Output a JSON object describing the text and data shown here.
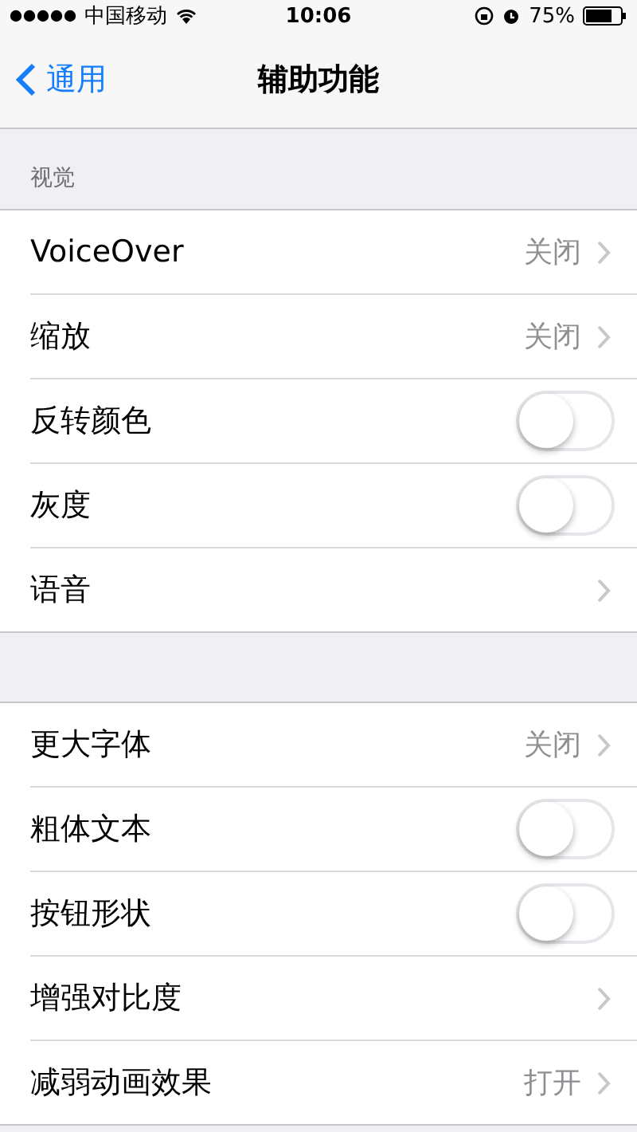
{
  "status_bar": {
    "carrier": "中国移动",
    "time": "10:06",
    "battery": "75%"
  },
  "nav": {
    "back": "通用",
    "title": "辅助功能"
  },
  "sections": [
    {
      "header": "视觉",
      "rows": [
        {
          "kind": "link",
          "label": "VoiceOver",
          "value": "关闭"
        },
        {
          "kind": "link",
          "label": "缩放",
          "value": "关闭"
        },
        {
          "kind": "toggle",
          "label": "反转颜色",
          "on": false
        },
        {
          "kind": "toggle",
          "label": "灰度",
          "on": false
        },
        {
          "kind": "link",
          "label": "语音"
        }
      ]
    },
    {
      "rows": [
        {
          "kind": "link",
          "label": "更大字体",
          "value": "关闭"
        },
        {
          "kind": "toggle",
          "label": "粗体文本",
          "on": false
        },
        {
          "kind": "toggle",
          "label": "按钮形状",
          "on": false
        },
        {
          "kind": "link",
          "label": "增强对比度"
        },
        {
          "kind": "link",
          "label": "减弱动画效果",
          "value": "打开"
        }
      ]
    }
  ]
}
